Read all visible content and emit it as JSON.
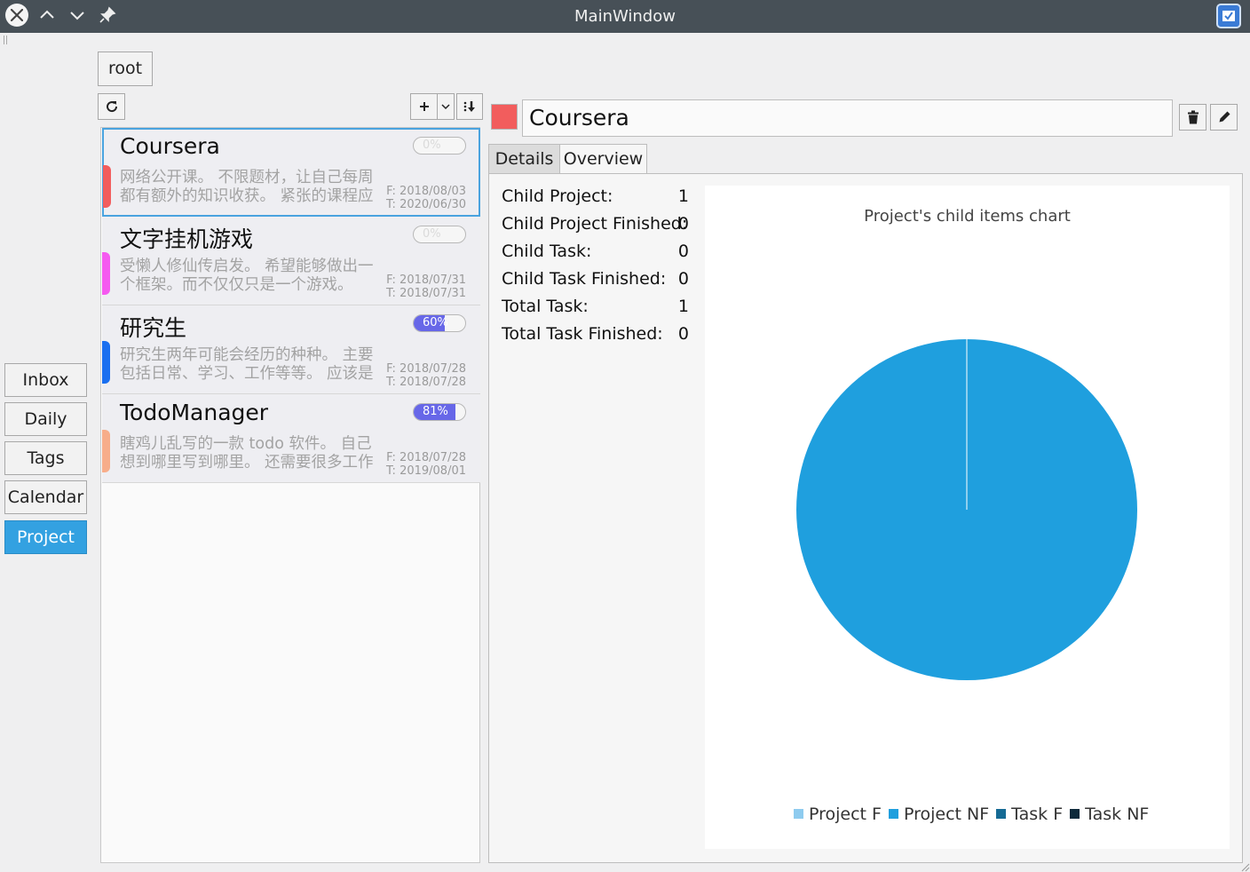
{
  "window": {
    "title": "MainWindow"
  },
  "nav": {
    "items": [
      {
        "label": "Inbox"
      },
      {
        "label": "Daily"
      },
      {
        "label": "Tags"
      },
      {
        "label": "Calendar"
      },
      {
        "label": "Project",
        "active": true
      }
    ]
  },
  "breadcrumb": {
    "root_label": "root"
  },
  "projects": [
    {
      "title": "Coursera",
      "desc_line1": "网络公开课。 不限题材，让自己每周",
      "desc_line2": "都有额外的知识收获。 紧张的课程应",
      "from": "F: 2018/08/03",
      "to": "T: 2020/06/30",
      "progress_label": "0%",
      "progress": 0,
      "color": "#f25d5d",
      "selected": true
    },
    {
      "title": "文字挂机游戏",
      "desc_line1": "受懒人修仙传启发。 希望能够做出一",
      "desc_line2": "个框架。而不仅仅只是一个游戏。",
      "from": "F: 2018/07/31",
      "to": "T: 2018/07/31",
      "progress_label": "0%",
      "progress": 0,
      "color": "#f55af0"
    },
    {
      "title": "研究生",
      "desc_line1": "研究生两年可能会经历的种种。 主要",
      "desc_line2": "包括日常、学习、工作等等。 应该是",
      "from": "F: 2018/07/28",
      "to": "T: 2018/07/28",
      "progress_label": "60%",
      "progress": 60,
      "color": "#1a6ff0"
    },
    {
      "title": "TodoManager",
      "desc_line1": "瞎鸡儿乱写的一款 todo 软件。 自己",
      "desc_line2": "想到哪里写到哪里。 还需要很多工作",
      "from": "F: 2018/07/28",
      "to": "T: 2019/08/01",
      "progress_label": "81%",
      "progress": 81,
      "color": "#f7ad8a"
    }
  ],
  "detail": {
    "name": "Coursera",
    "color": "#f25d5d",
    "tabs": [
      {
        "label": "Details"
      },
      {
        "label": "Overview",
        "active": true
      }
    ],
    "stats": [
      {
        "label": "Child Project:",
        "value": "1"
      },
      {
        "label": "Child Project Finished:",
        "value": "0"
      },
      {
        "label": "Child Task:",
        "value": "0"
      },
      {
        "label": "Child Task Finished:",
        "value": "0"
      },
      {
        "label": "Total Task:",
        "value": "1"
      },
      {
        "label": "Total Task Finished:",
        "value": "0"
      }
    ]
  },
  "chart_data": {
    "type": "pie",
    "title": "Project's child items chart",
    "categories": [
      "Project F",
      "Project NF",
      "Task F",
      "Task NF"
    ],
    "values": [
      0,
      1,
      0,
      0
    ],
    "colors": [
      "#8ecbef",
      "#1f9fde",
      "#156a94",
      "#0d2a3c"
    ],
    "legend_position": "bottom"
  }
}
